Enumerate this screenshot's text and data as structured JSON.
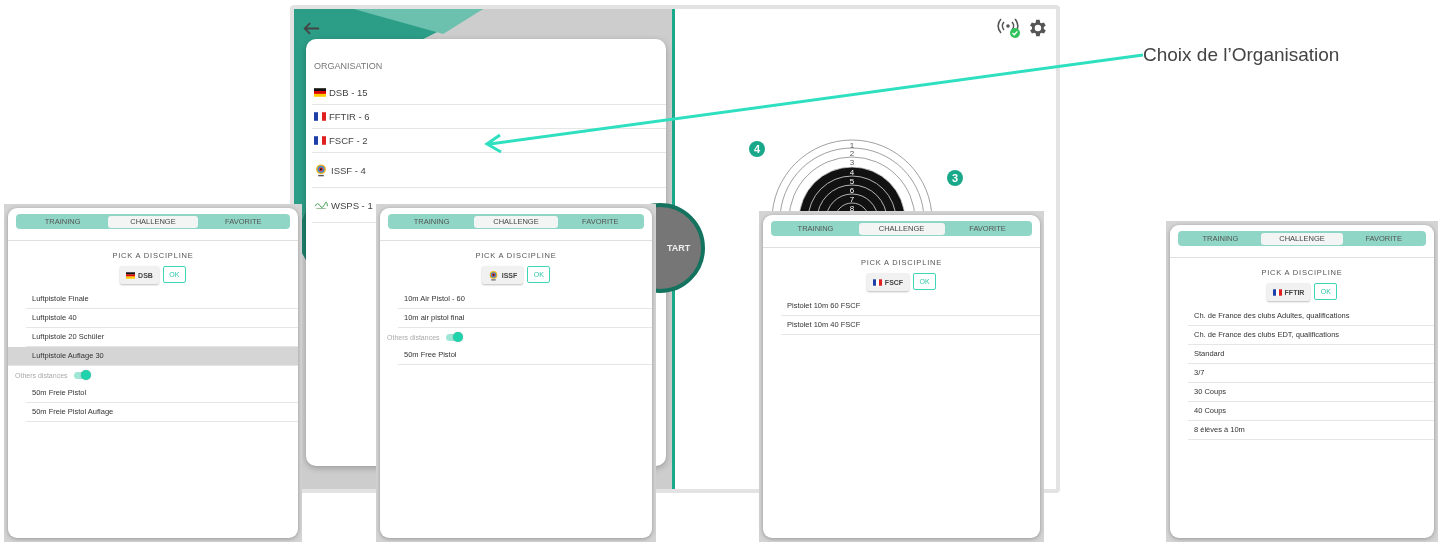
{
  "main_screen": {
    "organisation_menu": {
      "title": "ORGANISATION",
      "items": [
        {
          "kind": "de",
          "label": "DSB - 15"
        },
        {
          "kind": "fr",
          "label": "FFTIR - 6"
        },
        {
          "kind": "fr",
          "label": "FSCF - 2"
        },
        {
          "kind": "issf",
          "label": "ISSF - 4"
        },
        {
          "kind": "wsps",
          "label": "WSPS - 1"
        }
      ]
    },
    "start_button": {
      "label": "TART"
    },
    "target": {
      "ring_labels": [
        "1",
        "2",
        "3",
        "4",
        "5",
        "6",
        "7",
        "8"
      ],
      "badges": [
        "4",
        "3"
      ]
    },
    "connection": {
      "connected": true
    }
  },
  "annotation": {
    "text": "Choix de l’Organisation"
  },
  "panels": [
    {
      "tabs": [
        {
          "label": "TRAINING",
          "selected": false
        },
        {
          "label": "CHALLENGE",
          "selected": true
        },
        {
          "label": "FAVORITE",
          "selected": false
        }
      ],
      "heading": "PICK A DISCIPLINE",
      "org": {
        "kind": "de",
        "label": "DSB"
      },
      "ok": "OK",
      "disciplines": [
        {
          "label": "Luftpistole Finale",
          "selected": false
        },
        {
          "label": "Luftpistole 40",
          "selected": false
        },
        {
          "label": "Luftpistole 20 Schüler",
          "selected": false
        },
        {
          "label": "Luftpistole Auflage 30",
          "selected": true
        }
      ],
      "toggle": {
        "label": "Others distances",
        "on": true
      },
      "other_disciplines": [
        {
          "label": "50m Freie Pistol",
          "selected": false
        },
        {
          "label": "50m Freie Pistol Auflage",
          "selected": false
        }
      ]
    },
    {
      "tabs": [
        {
          "label": "TRAINING",
          "selected": false
        },
        {
          "label": "CHALLENGE",
          "selected": true
        },
        {
          "label": "FAVORITE",
          "selected": false
        }
      ],
      "heading": "PICK A DISCIPLINE",
      "org": {
        "kind": "issf",
        "label": "ISSF"
      },
      "ok": "OK",
      "disciplines": [
        {
          "label": "10m Air Pistol - 60",
          "selected": false
        },
        {
          "label": "10m air pistol final",
          "selected": false
        }
      ],
      "toggle": {
        "label": "Others distances",
        "on": true
      },
      "other_disciplines": [
        {
          "label": "50m Free Pistol",
          "selected": false
        }
      ]
    },
    {
      "tabs": [
        {
          "label": "TRAINING",
          "selected": false
        },
        {
          "label": "CHALLENGE",
          "selected": true
        },
        {
          "label": "FAVORITE",
          "selected": false
        }
      ],
      "heading": "PICK A DISCIPLINE",
      "org": {
        "kind": "fr",
        "label": "FSCF"
      },
      "ok": "OK",
      "disciplines": [
        {
          "label": "Pistolet 10m 60 FSCF",
          "selected": false
        },
        {
          "label": "Pistolet 10m 40 FSCF",
          "selected": false
        }
      ]
    },
    {
      "tabs": [
        {
          "label": "TRAINING",
          "selected": false
        },
        {
          "label": "CHALLENGE",
          "selected": true
        },
        {
          "label": "FAVORITE",
          "selected": false
        }
      ],
      "heading": "PICK A DISCIPLINE",
      "org": {
        "kind": "fr",
        "label": "FFTIR"
      },
      "ok": "OK",
      "disciplines": [
        {
          "label": "Ch. de France des clubs Adultes, qualifications",
          "selected": false
        },
        {
          "label": "Ch. de France des clubs EDT, qualifications",
          "selected": false
        },
        {
          "label": "Standard",
          "selected": false
        },
        {
          "label": "3/7",
          "selected": false
        },
        {
          "label": "30 Coups",
          "selected": false
        },
        {
          "label": "40 Coups",
          "selected": false
        },
        {
          "label": "8 élèves à 10m",
          "selected": false
        }
      ]
    }
  ]
}
